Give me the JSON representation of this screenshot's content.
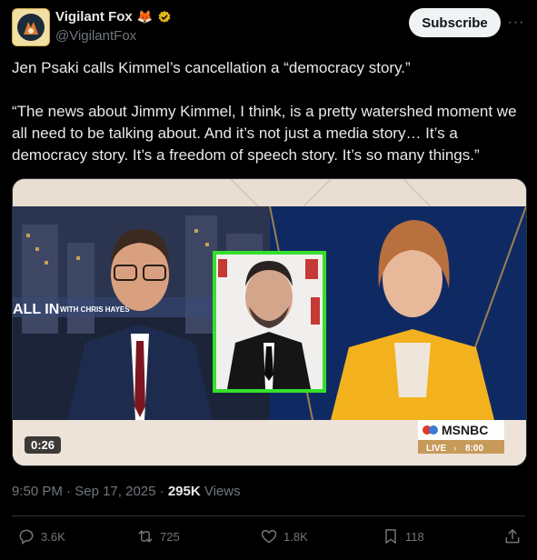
{
  "author": {
    "display_name": "Vigilant Fox",
    "emoji": "🦊",
    "handle": "@VigilantFox"
  },
  "subscribe_label": "Subscribe",
  "more_label": "···",
  "tweet": {
    "text": "Jen Psaki calls Kimmel’s cancellation a “democracy story.”\n\n“The news about Jimmy Kimmel, I think, is a pretty watershed moment we all need to be talking about. And it’s not just a media story… It’s a democracy story. It’s a freedom of speech story. It’s so many things.”"
  },
  "video": {
    "duration": "0:26",
    "lower_third_left": "ALL IN",
    "lower_third_sub": "WITH CHRIS HAYES",
    "network": "MSNBC",
    "live_text": "LIVE",
    "live_time": "8:00",
    "colors": {
      "green_border": "#35e02b",
      "msnbc_bar": "#c79a5a"
    }
  },
  "meta": {
    "time": "9:50 PM",
    "date": "Sep 17, 2025",
    "views_count": "295K",
    "views_label": "Views",
    "separator": "·"
  },
  "actions": {
    "replies": "3.6K",
    "reposts": "725",
    "likes": "1.8K",
    "bookmarks": "118"
  },
  "icons": [
    "verified-badge-icon",
    "more-icon",
    "reply-icon",
    "repost-icon",
    "like-icon",
    "bookmark-icon",
    "share-icon"
  ],
  "colors": {
    "accent_verified": "#e2b719",
    "muted": "#71767b",
    "text": "#e7e9ea"
  }
}
